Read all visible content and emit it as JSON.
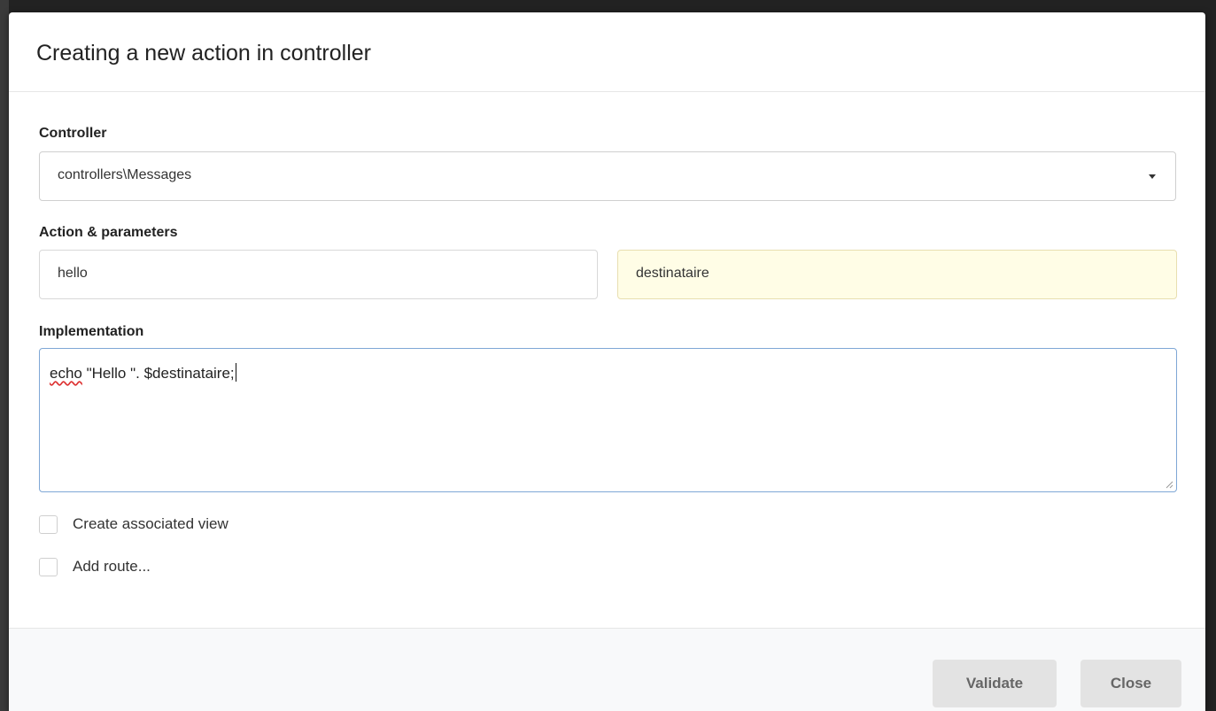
{
  "dialog": {
    "title": "Creating a new action in controller"
  },
  "controller": {
    "label": "Controller",
    "selected": "controllers\\Messages"
  },
  "action": {
    "label": "Action & parameters",
    "name_value": "hello",
    "params_value": "destinataire"
  },
  "implementation": {
    "label": "Implementation",
    "code_keyword": "echo",
    "code_rest": " \"Hello \". $destinataire;"
  },
  "options": {
    "create_view_label": "Create associated view",
    "add_route_label": "Add route..."
  },
  "footer": {
    "validate_label": "Validate",
    "close_label": "Close"
  },
  "colors": {
    "param_field_bg": "#fffde6",
    "focus_border": "#7fa7d6",
    "footer_bg": "#f8f9fa",
    "button_bg": "#e3e3e3"
  }
}
